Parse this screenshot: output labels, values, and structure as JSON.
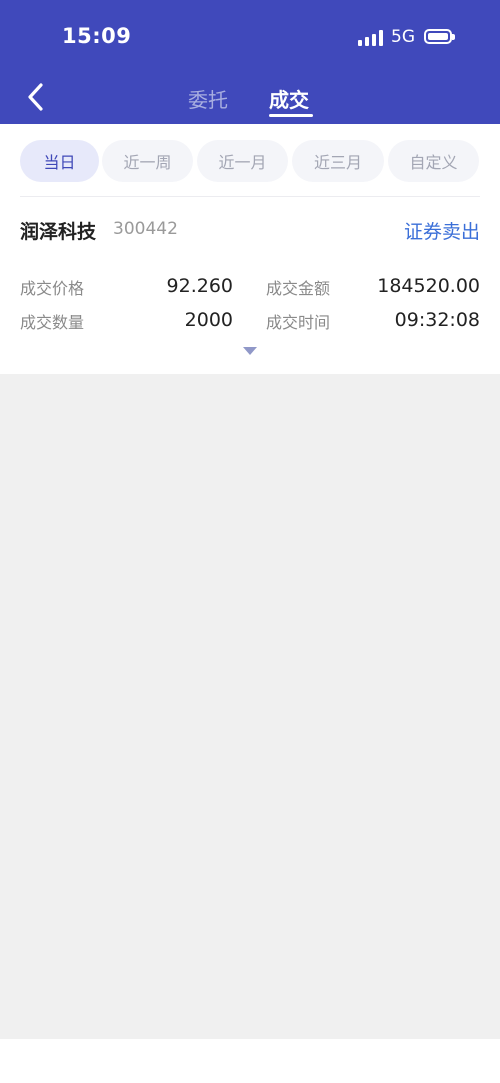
{
  "status_bar": {
    "time": "15:09",
    "network": "5G",
    "icons": [
      "signal-icon",
      "battery-icon"
    ]
  },
  "nav": {
    "back_icon": "chevron-left-icon",
    "tabs": [
      {
        "label": "委托",
        "active": false
      },
      {
        "label": "成交",
        "active": true
      }
    ]
  },
  "filters": [
    {
      "label": "当日",
      "selected": true
    },
    {
      "label": "近一周",
      "selected": false
    },
    {
      "label": "近一月",
      "selected": false
    },
    {
      "label": "近三月",
      "selected": false
    },
    {
      "label": "自定义",
      "selected": false
    }
  ],
  "trade": {
    "stock_name": "润泽科技",
    "stock_code": "300442",
    "type": "证券卖出",
    "fields": {
      "price_label": "成交价格",
      "price": "92.260",
      "amount_label": "成交金额",
      "amount": "184520.00",
      "qty_label": "成交数量",
      "qty": "2000",
      "time_label": "成交时间",
      "time": "09:32:08"
    }
  },
  "colors": {
    "header": "#4049bb",
    "accent": "#3b6fd8",
    "chip_selected_bg": "#e7e9fa",
    "page_gray": "#f0f0f0"
  }
}
